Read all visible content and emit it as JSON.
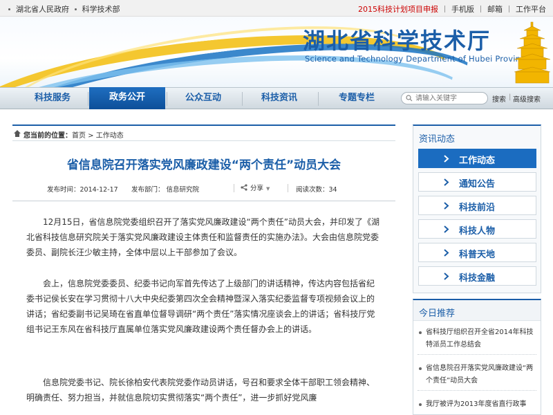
{
  "topbar": {
    "left_links": [
      "湖北省人民政府",
      "科学技术部"
    ],
    "right_links": [
      "2015科技计划项目申报",
      "手机版",
      "邮箱",
      "工作平台"
    ],
    "highlight_color": "#cc0000"
  },
  "banner": {
    "title": "湖北省科学技术厅",
    "subtitle": "Science and Technology Department of Hubei Province"
  },
  "nav": {
    "items": [
      "科技服务",
      "政务公开",
      "公众互动",
      "科技资讯",
      "专题专栏"
    ],
    "active": "政务公开",
    "search_placeholder": "请输入关键字",
    "search_label": "搜索",
    "advanced_search_label": "高级搜索"
  },
  "breadcrumb": {
    "label": "您当前的位置：",
    "path": "首页 > 工作动态"
  },
  "article": {
    "title": "省信息院召开落实党风廉政建设“两个责任”动员大会",
    "publish_time": "发布时间：2014-12-17",
    "department": "发布部门：  信息研究院",
    "share_label": "分享",
    "views": "阅读次数：34",
    "paragraphs": [
      "12月15日，省信息院党委组织召开了落实党风廉政建设“两个责任”动员大会，并印发了《湖北省科技信息研究院关于落实党风廉政建设主体责任和监督责任的实施办法》。大会由信息院党委委员、副院长汪少敏主持，全体中层以上干部参加了会议。",
      "会上，信息院党委委员、纪委书记向军首先传达了上级部门的讲话精神，传达内容包括省纪委书记侯长安在学习贯彻十八大中央纪委第四次全会精神暨深入落实纪委监督专项视频会议上的讲话；省纪委副书记吴琦在省直单位督导调研“两个责任”落实情况座谈会上的讲话；省科技厅党组书记王东风在省科技厅直属单位落实党风廉政建设两个责任督办会上的讲话。",
      "信息院党委书记、院长徐柏安代表院党委作动员讲话，号召和要求全体干部职工领会精神、明确责任、努力担当，并就信息院切实贯彻落实“两个责任”，进一步抓好党风廉"
    ]
  },
  "sidebar": {
    "news_header": "资讯动态",
    "menu": [
      "工作动态",
      "通知公告",
      "科技前沿",
      "科技人物",
      "科普天地",
      "科技金融"
    ],
    "active_menu": "工作动态",
    "today_header": "今日推荐",
    "recommended": [
      "省科技厅组织召开全省2014年科技特派员工作总结会",
      "省信息院召开落实党风廉政建设“两个责任”动员大会",
      "我厅被评为2013年度省直行政事"
    ]
  },
  "colors": {
    "brand_blue": "#1b5ea8",
    "active_blue": "#1b6cc0"
  }
}
